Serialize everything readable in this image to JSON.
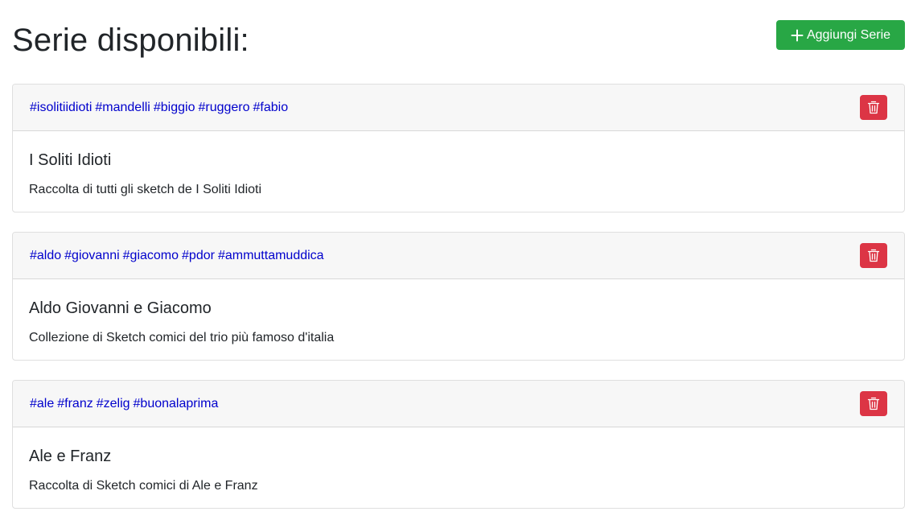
{
  "page": {
    "title": "Serie disponibili:",
    "add_button_label": "Aggiungi Serie"
  },
  "series": [
    {
      "tags": [
        "#isolitiidioti",
        "#mandelli",
        "#biggio",
        "#ruggero",
        "#fabio"
      ],
      "title": "I Soliti Idioti",
      "description": "Raccolta di tutti gli sketch de I Soliti Idioti"
    },
    {
      "tags": [
        "#aldo",
        "#giovanni",
        "#giacomo",
        "#pdor",
        "#ammuttamuddica"
      ],
      "title": "Aldo Giovanni e Giacomo",
      "description": "Collezione di Sketch comici del trio più famoso d'italia"
    },
    {
      "tags": [
        "#ale",
        "#franz",
        "#zelig",
        "#buonalaprima"
      ],
      "title": "Ale e Franz",
      "description": "Raccolta di Sketch comici di Ale e Franz"
    }
  ],
  "icons": {
    "add": "plus-icon",
    "delete": "trash-icon"
  },
  "colors": {
    "add_button": "#28a745",
    "delete_button": "#dc3545",
    "tag_link": "#0000cc",
    "card_header": "#f7f7f7"
  }
}
